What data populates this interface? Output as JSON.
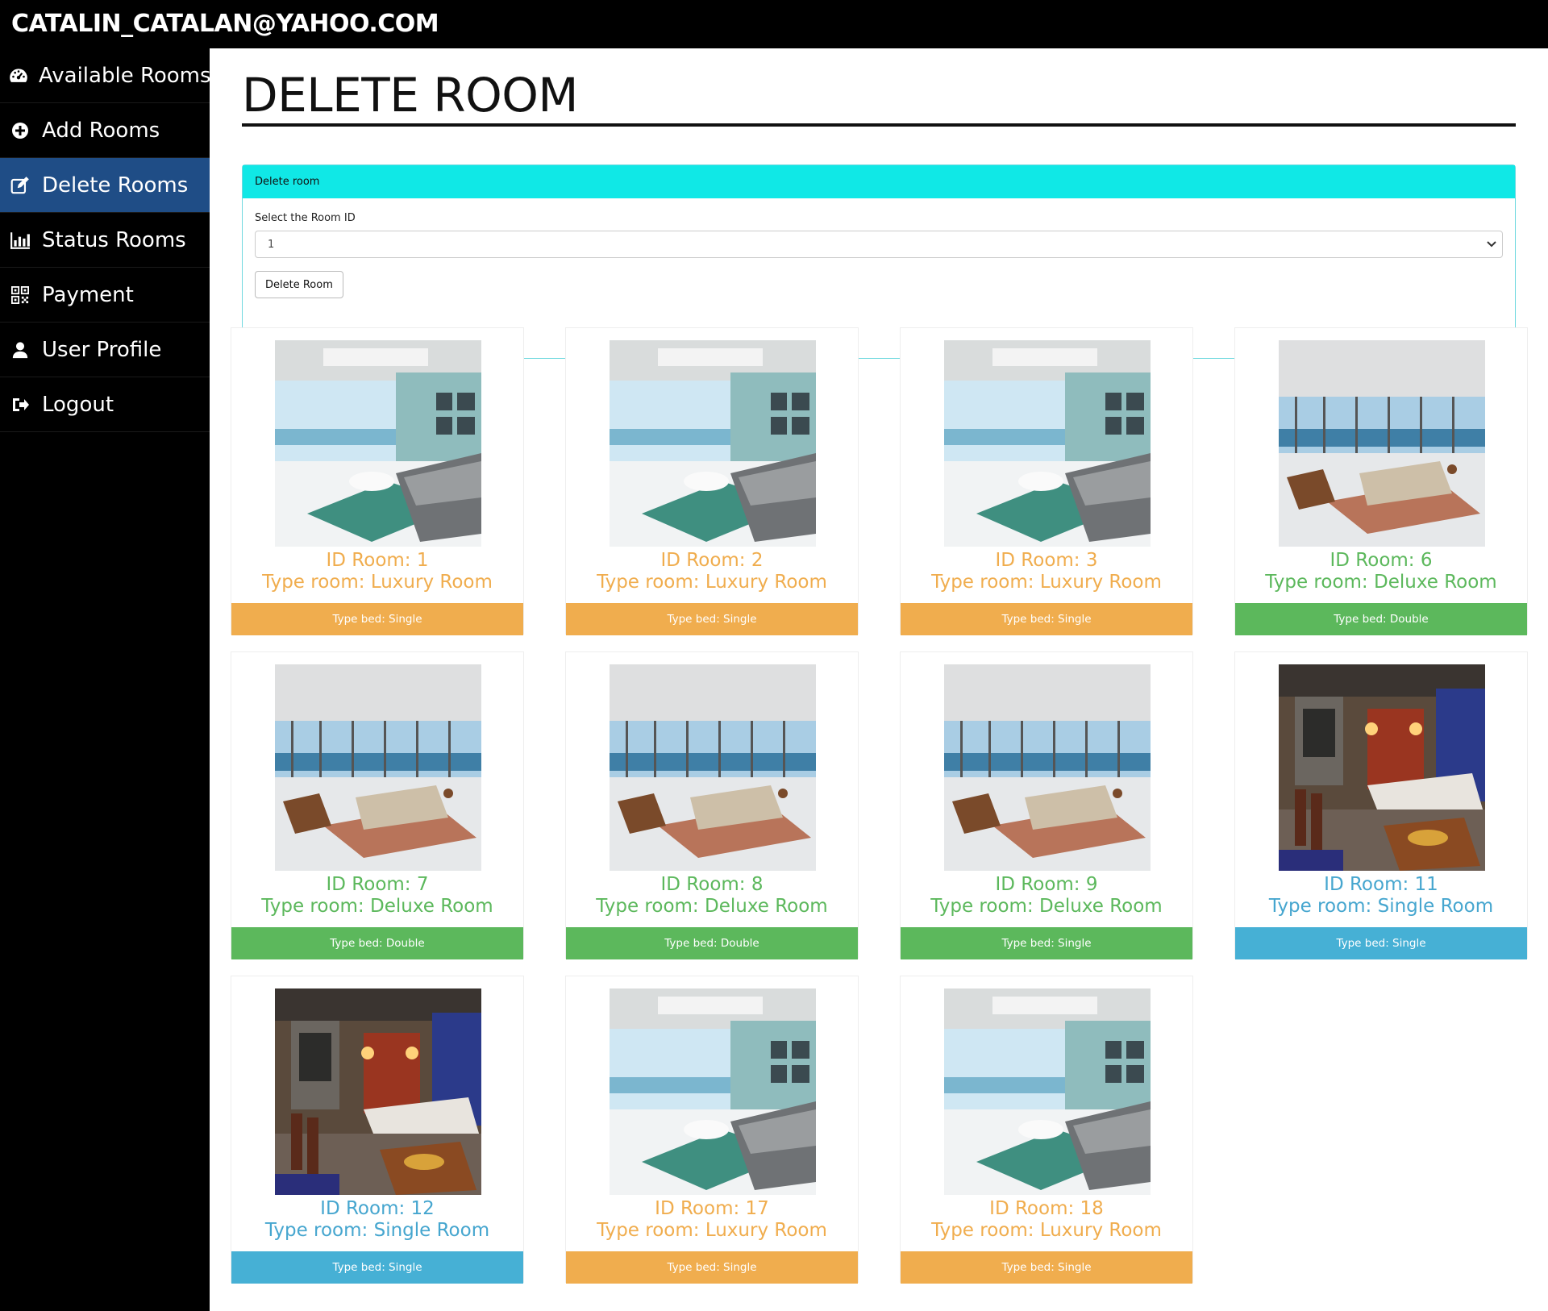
{
  "header": {
    "user_email": "CATALIN_CATALAN@YAHOO.COM"
  },
  "sidebar": {
    "items": [
      {
        "label": "Available Rooms",
        "icon": "dashboard-icon"
      },
      {
        "label": "Add Rooms",
        "icon": "plus-circle-icon"
      },
      {
        "label": "Delete Rooms",
        "icon": "edit-icon",
        "active": true
      },
      {
        "label": "Status Rooms",
        "icon": "bar-chart-icon"
      },
      {
        "label": "Payment",
        "icon": "qrcode-icon"
      },
      {
        "label": "User Profile",
        "icon": "user-icon"
      },
      {
        "label": "Logout",
        "icon": "logout-icon"
      }
    ]
  },
  "page": {
    "title": "DELETE ROOM"
  },
  "panel": {
    "heading": "Delete room",
    "select_label": "Select the Room ID",
    "selected_value": "1",
    "button_label": "Delete Room"
  },
  "colors": {
    "luxury": "#f0ad4e",
    "deluxe": "#5cb85c",
    "single": "#46b0d5",
    "panel_head": "#10e8e6",
    "active_nav": "#1f4d86"
  },
  "rooms": [
    {
      "id_label": "ID Room: 1",
      "type_label": "Type room: Luxury Room",
      "bed_label": "Type bed: Single",
      "image": "luxury-room-photo"
    },
    {
      "id_label": "ID Room: 2",
      "type_label": "Type room: Luxury Room",
      "bed_label": "Type bed: Single",
      "image": "luxury-room-photo"
    },
    {
      "id_label": "ID Room: 3",
      "type_label": "Type room: Luxury Room",
      "bed_label": "Type bed: Single",
      "image": "luxury-room-photo"
    },
    {
      "id_label": "ID Room: 6",
      "type_label": "Type room: Deluxe Room",
      "bed_label": "Type bed: Double",
      "image": "deluxe-room-photo"
    },
    {
      "id_label": "ID Room: 7",
      "type_label": "Type room: Deluxe Room",
      "bed_label": "Type bed: Double",
      "image": "deluxe-room-photo"
    },
    {
      "id_label": "ID Room: 8",
      "type_label": "Type room: Deluxe Room",
      "bed_label": "Type bed: Double",
      "image": "deluxe-room-photo"
    },
    {
      "id_label": "ID Room: 9",
      "type_label": "Type room: Deluxe Room",
      "bed_label": "Type bed: Single",
      "image": "deluxe-room-photo"
    },
    {
      "id_label": "ID Room: 11",
      "type_label": "Type room: Single Room",
      "bed_label": "Type bed: Single",
      "image": "single-room-photo"
    },
    {
      "id_label": "ID Room: 12",
      "type_label": "Type room: Single Room",
      "bed_label": "Type bed: Single",
      "image": "single-room-photo"
    },
    {
      "id_label": "ID Room: 17",
      "type_label": "Type room: Luxury Room",
      "bed_label": "Type bed: Single",
      "image": "luxury-room-photo"
    },
    {
      "id_label": "ID Room: 18",
      "type_label": "Type room: Luxury Room",
      "bed_label": "Type bed: Single",
      "image": "luxury-room-photo"
    }
  ]
}
